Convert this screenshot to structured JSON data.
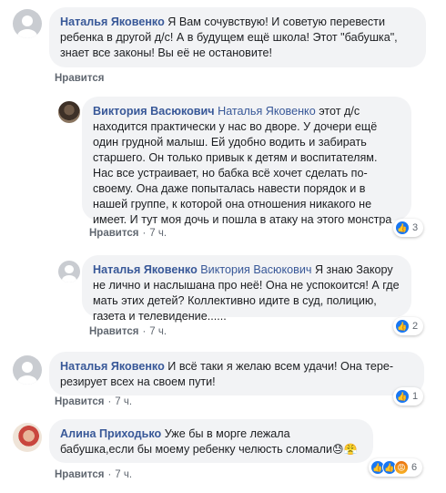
{
  "comments": [
    {
      "author": "Наталья Яковенко",
      "text": "Я Вам сочувствую! И советую перевести ребенка в другой д/с! А в будущем ещё школа! Этот \"бабушка\", знает все законы! Вы её не остановите!",
      "like_label": "Нравится",
      "time": ""
    },
    {
      "author": "Виктория Васюкович",
      "mention": "Наталья Яковенко",
      "text": "этот д/с находится практически у нас во дворе. У дочери ещё один грудной малыш. Ей удобно водить и забирать старшего. Он только привык к детям и воспитателям. Нас все устраивает, но бабка всё хочет сделать по-своему. Она даже попыталась навести порядок и в нашей группе, к которой она отношения никакого не имеет. И тут моя дочь и пошла в атаку на этого монстра",
      "like_label": "Нравится",
      "time": "7 ч.",
      "reaction_count": "3"
    },
    {
      "author": "Наталья Яковенко",
      "mention": "Виктория Васюкович",
      "text": "Я знаю Закору не лично и наслышана про неё! Она не успокоится! А где мать этих детей? Коллективно идите в суд, полицию, газета и телевидение......",
      "like_label": "Нравится",
      "time": "7 ч.",
      "reaction_count": "2"
    },
    {
      "author": "Наталья Яковенко",
      "text": "И всё таки я желаю всем удачи! Она тере­резирует всех на своем пути!",
      "like_label": "Нравится",
      "time": "7 ч.",
      "reaction_count": "1"
    },
    {
      "author": "Алина Приходько",
      "text": "Уже бы в морге лежала бабушка,если бы моему ребенку челюсть сломали",
      "emoji": "😓😤",
      "like_label": "Нравится",
      "time": "7 ч.",
      "reaction_count": "6"
    }
  ],
  "separator": "·",
  "icons": {
    "like": "thumbs-up-icon",
    "angry": "angry-face-icon"
  },
  "colors": {
    "author": "#385898",
    "bubble": "#f2f3f5",
    "like_reaction": "#1877f2"
  }
}
